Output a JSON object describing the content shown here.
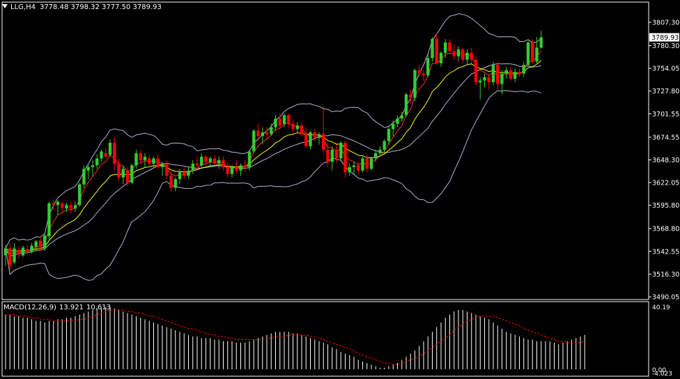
{
  "header": {
    "symbol_tf": "LLG,H4",
    "ohlc": "3778.48 3798.32 3777.50 3789.93"
  },
  "macd_header": {
    "name": "MACD(12,26,9)",
    "main": "13.921",
    "signal": "10.613"
  },
  "colors": {
    "background": "#000000",
    "up_candle": "#32cd32",
    "down_candle": "#ff0000",
    "bollinger": "#b4b4d2",
    "ema_fast": "#ff3030",
    "ema_slow": "#ffff00",
    "macd_hist": "#ffffff",
    "macd_signal": "#ff0000",
    "axis": "#ffffff",
    "price_label_bg": "#ffffff"
  },
  "chart_data": [
    {
      "type": "candlestick",
      "series_name": "LLG,H4",
      "y_axis_ticks": [
        "3807.30",
        "3780.30",
        "3754.05",
        "3727.80",
        "3701.55",
        "3674.55",
        "3648.30",
        "3622.05",
        "3595.80",
        "3568.80",
        "3542.55",
        "3516.30",
        "3490.05"
      ],
      "ylim": [
        3490.05,
        3807.3
      ],
      "current_price_label": "3789.93",
      "candles": [
        {
          "o": 3538,
          "h": 3550,
          "l": 3526,
          "c": 3546
        },
        {
          "o": 3546,
          "h": 3552,
          "l": 3520,
          "c": 3526
        },
        {
          "o": 3530,
          "h": 3552,
          "l": 3528,
          "c": 3546
        },
        {
          "o": 3544,
          "h": 3548,
          "l": 3534,
          "c": 3539
        },
        {
          "o": 3538,
          "h": 3549,
          "l": 3536,
          "c": 3547
        },
        {
          "o": 3545,
          "h": 3549,
          "l": 3538,
          "c": 3542
        },
        {
          "o": 3542,
          "h": 3552,
          "l": 3540,
          "c": 3549
        },
        {
          "o": 3548,
          "h": 3556,
          "l": 3544,
          "c": 3554
        },
        {
          "o": 3555,
          "h": 3558,
          "l": 3544,
          "c": 3547
        },
        {
          "o": 3546,
          "h": 3564,
          "l": 3543,
          "c": 3561
        },
        {
          "o": 3560,
          "h": 3600,
          "l": 3556,
          "c": 3598
        },
        {
          "o": 3598,
          "h": 3603,
          "l": 3590,
          "c": 3596
        },
        {
          "o": 3596,
          "h": 3602,
          "l": 3584,
          "c": 3600
        },
        {
          "o": 3598,
          "h": 3600,
          "l": 3588,
          "c": 3593
        },
        {
          "o": 3592,
          "h": 3599,
          "l": 3588,
          "c": 3596
        },
        {
          "o": 3596,
          "h": 3600,
          "l": 3586,
          "c": 3592
        },
        {
          "o": 3592,
          "h": 3600,
          "l": 3588,
          "c": 3596
        },
        {
          "o": 3596,
          "h": 3622,
          "l": 3594,
          "c": 3620
        },
        {
          "o": 3620,
          "h": 3642,
          "l": 3616,
          "c": 3638
        },
        {
          "o": 3636,
          "h": 3642,
          "l": 3626,
          "c": 3640
        },
        {
          "o": 3640,
          "h": 3648,
          "l": 3630,
          "c": 3642
        },
        {
          "o": 3642,
          "h": 3655,
          "l": 3638,
          "c": 3650
        },
        {
          "o": 3650,
          "h": 3660,
          "l": 3646,
          "c": 3658
        },
        {
          "o": 3656,
          "h": 3662,
          "l": 3650,
          "c": 3652
        },
        {
          "o": 3654,
          "h": 3672,
          "l": 3652,
          "c": 3668
        },
        {
          "o": 3668,
          "h": 3674,
          "l": 3636,
          "c": 3644
        },
        {
          "o": 3644,
          "h": 3650,
          "l": 3624,
          "c": 3628
        },
        {
          "o": 3628,
          "h": 3642,
          "l": 3620,
          "c": 3638
        },
        {
          "o": 3636,
          "h": 3640,
          "l": 3618,
          "c": 3622
        },
        {
          "o": 3622,
          "h": 3644,
          "l": 3620,
          "c": 3642
        },
        {
          "o": 3642,
          "h": 3660,
          "l": 3638,
          "c": 3656
        },
        {
          "o": 3656,
          "h": 3660,
          "l": 3644,
          "c": 3648
        },
        {
          "o": 3648,
          "h": 3656,
          "l": 3640,
          "c": 3652
        },
        {
          "o": 3650,
          "h": 3654,
          "l": 3640,
          "c": 3644
        },
        {
          "o": 3644,
          "h": 3652,
          "l": 3640,
          "c": 3650
        },
        {
          "o": 3650,
          "h": 3654,
          "l": 3638,
          "c": 3640
        },
        {
          "o": 3640,
          "h": 3646,
          "l": 3630,
          "c": 3644
        },
        {
          "o": 3644,
          "h": 3648,
          "l": 3626,
          "c": 3630
        },
        {
          "o": 3630,
          "h": 3634,
          "l": 3612,
          "c": 3616
        },
        {
          "o": 3616,
          "h": 3628,
          "l": 3612,
          "c": 3626
        },
        {
          "o": 3626,
          "h": 3638,
          "l": 3620,
          "c": 3634
        },
        {
          "o": 3634,
          "h": 3640,
          "l": 3626,
          "c": 3630
        },
        {
          "o": 3630,
          "h": 3640,
          "l": 3626,
          "c": 3636
        },
        {
          "o": 3636,
          "h": 3648,
          "l": 3632,
          "c": 3644
        },
        {
          "o": 3644,
          "h": 3652,
          "l": 3638,
          "c": 3642
        },
        {
          "o": 3642,
          "h": 3656,
          "l": 3640,
          "c": 3652
        },
        {
          "o": 3652,
          "h": 3654,
          "l": 3642,
          "c": 3646
        },
        {
          "o": 3646,
          "h": 3652,
          "l": 3640,
          "c": 3650
        },
        {
          "o": 3650,
          "h": 3654,
          "l": 3642,
          "c": 3644
        },
        {
          "o": 3644,
          "h": 3652,
          "l": 3638,
          "c": 3648
        },
        {
          "o": 3648,
          "h": 3652,
          "l": 3636,
          "c": 3640
        },
        {
          "o": 3640,
          "h": 3646,
          "l": 3628,
          "c": 3632
        },
        {
          "o": 3632,
          "h": 3642,
          "l": 3628,
          "c": 3640
        },
        {
          "o": 3640,
          "h": 3648,
          "l": 3632,
          "c": 3636
        },
        {
          "o": 3636,
          "h": 3644,
          "l": 3630,
          "c": 3642
        },
        {
          "o": 3642,
          "h": 3648,
          "l": 3634,
          "c": 3640
        },
        {
          "o": 3640,
          "h": 3660,
          "l": 3636,
          "c": 3658
        },
        {
          "o": 3658,
          "h": 3684,
          "l": 3656,
          "c": 3682
        },
        {
          "o": 3682,
          "h": 3690,
          "l": 3670,
          "c": 3676
        },
        {
          "o": 3676,
          "h": 3686,
          "l": 3666,
          "c": 3680
        },
        {
          "o": 3680,
          "h": 3686,
          "l": 3672,
          "c": 3678
        },
        {
          "o": 3678,
          "h": 3690,
          "l": 3676,
          "c": 3686
        },
        {
          "o": 3686,
          "h": 3700,
          "l": 3682,
          "c": 3696
        },
        {
          "o": 3696,
          "h": 3702,
          "l": 3684,
          "c": 3688
        },
        {
          "o": 3690,
          "h": 3702,
          "l": 3686,
          "c": 3700
        },
        {
          "o": 3700,
          "h": 3702,
          "l": 3686,
          "c": 3690
        },
        {
          "o": 3690,
          "h": 3694,
          "l": 3680,
          "c": 3684
        },
        {
          "o": 3684,
          "h": 3692,
          "l": 3680,
          "c": 3688
        },
        {
          "o": 3688,
          "h": 3692,
          "l": 3676,
          "c": 3678
        },
        {
          "o": 3678,
          "h": 3686,
          "l": 3662,
          "c": 3664
        },
        {
          "o": 3664,
          "h": 3682,
          "l": 3660,
          "c": 3680
        },
        {
          "o": 3680,
          "h": 3684,
          "l": 3670,
          "c": 3674
        },
        {
          "o": 3674,
          "h": 3680,
          "l": 3666,
          "c": 3678
        },
        {
          "o": 3678,
          "h": 3710,
          "l": 3656,
          "c": 3660
        },
        {
          "o": 3660,
          "h": 3668,
          "l": 3640,
          "c": 3646
        },
        {
          "o": 3646,
          "h": 3664,
          "l": 3636,
          "c": 3660
        },
        {
          "o": 3660,
          "h": 3666,
          "l": 3644,
          "c": 3650
        },
        {
          "o": 3650,
          "h": 3670,
          "l": 3646,
          "c": 3668
        },
        {
          "o": 3668,
          "h": 3670,
          "l": 3628,
          "c": 3634
        },
        {
          "o": 3634,
          "h": 3644,
          "l": 3630,
          "c": 3640
        },
        {
          "o": 3640,
          "h": 3646,
          "l": 3632,
          "c": 3642
        },
        {
          "o": 3642,
          "h": 3646,
          "l": 3632,
          "c": 3636
        },
        {
          "o": 3636,
          "h": 3652,
          "l": 3634,
          "c": 3650
        },
        {
          "o": 3650,
          "h": 3654,
          "l": 3634,
          "c": 3638
        },
        {
          "o": 3638,
          "h": 3652,
          "l": 3636,
          "c": 3650
        },
        {
          "o": 3650,
          "h": 3660,
          "l": 3646,
          "c": 3656
        },
        {
          "o": 3656,
          "h": 3664,
          "l": 3652,
          "c": 3660
        },
        {
          "o": 3660,
          "h": 3672,
          "l": 3656,
          "c": 3670
        },
        {
          "o": 3670,
          "h": 3686,
          "l": 3666,
          "c": 3684
        },
        {
          "o": 3684,
          "h": 3694,
          "l": 3676,
          "c": 3690
        },
        {
          "o": 3690,
          "h": 3700,
          "l": 3686,
          "c": 3696
        },
        {
          "o": 3696,
          "h": 3704,
          "l": 3692,
          "c": 3700
        },
        {
          "o": 3700,
          "h": 3726,
          "l": 3698,
          "c": 3724
        },
        {
          "o": 3724,
          "h": 3730,
          "l": 3714,
          "c": 3720
        },
        {
          "o": 3720,
          "h": 3754,
          "l": 3716,
          "c": 3752
        },
        {
          "o": 3752,
          "h": 3758,
          "l": 3744,
          "c": 3748
        },
        {
          "o": 3748,
          "h": 3752,
          "l": 3740,
          "c": 3746
        },
        {
          "o": 3746,
          "h": 3770,
          "l": 3744,
          "c": 3766
        },
        {
          "o": 3766,
          "h": 3790,
          "l": 3762,
          "c": 3788
        },
        {
          "o": 3788,
          "h": 3794,
          "l": 3758,
          "c": 3760
        },
        {
          "o": 3760,
          "h": 3774,
          "l": 3756,
          "c": 3772
        },
        {
          "o": 3772,
          "h": 3788,
          "l": 3766,
          "c": 3784
        },
        {
          "o": 3784,
          "h": 3788,
          "l": 3770,
          "c": 3774
        },
        {
          "o": 3774,
          "h": 3782,
          "l": 3764,
          "c": 3768
        },
        {
          "o": 3768,
          "h": 3780,
          "l": 3762,
          "c": 3776
        },
        {
          "o": 3776,
          "h": 3778,
          "l": 3760,
          "c": 3764
        },
        {
          "o": 3764,
          "h": 3776,
          "l": 3758,
          "c": 3772
        },
        {
          "o": 3772,
          "h": 3778,
          "l": 3760,
          "c": 3764
        },
        {
          "o": 3764,
          "h": 3768,
          "l": 3734,
          "c": 3738
        },
        {
          "o": 3738,
          "h": 3744,
          "l": 3718,
          "c": 3740
        },
        {
          "o": 3740,
          "h": 3748,
          "l": 3732,
          "c": 3744
        },
        {
          "o": 3744,
          "h": 3748,
          "l": 3730,
          "c": 3738
        },
        {
          "o": 3738,
          "h": 3762,
          "l": 3734,
          "c": 3758
        },
        {
          "o": 3758,
          "h": 3762,
          "l": 3730,
          "c": 3736
        },
        {
          "o": 3736,
          "h": 3752,
          "l": 3724,
          "c": 3748
        },
        {
          "o": 3748,
          "h": 3756,
          "l": 3742,
          "c": 3752
        },
        {
          "o": 3752,
          "h": 3756,
          "l": 3740,
          "c": 3742
        },
        {
          "o": 3742,
          "h": 3754,
          "l": 3738,
          "c": 3750
        },
        {
          "o": 3750,
          "h": 3754,
          "l": 3744,
          "c": 3748
        },
        {
          "o": 3748,
          "h": 3762,
          "l": 3744,
          "c": 3758
        },
        {
          "o": 3758,
          "h": 3786,
          "l": 3756,
          "c": 3784
        },
        {
          "o": 3784,
          "h": 3788,
          "l": 3760,
          "c": 3762
        },
        {
          "o": 3762,
          "h": 3790,
          "l": 3760,
          "c": 3778
        },
        {
          "o": 3778,
          "h": 3798,
          "l": 3777,
          "c": 3790
        }
      ]
    },
    {
      "type": "bar",
      "series_name": "MACD(12,26,9)",
      "y_axis_ticks": [
        "40.19",
        "0.00",
        "-4.023"
      ],
      "ylim": [
        -4.023,
        40.19
      ],
      "histogram": [
        35,
        35,
        34,
        34,
        33,
        33,
        32,
        31,
        31,
        30,
        31,
        31,
        32,
        32,
        33,
        33,
        34,
        35,
        36,
        37,
        38,
        39,
        39,
        40,
        40,
        39,
        38,
        37,
        36,
        35,
        34,
        33,
        32,
        31,
        30,
        29,
        28,
        27,
        26,
        25,
        24,
        23,
        22,
        21,
        21,
        20,
        20,
        20,
        19,
        19,
        18,
        18,
        18,
        17,
        17,
        17,
        18,
        19,
        20,
        21,
        22,
        23,
        24,
        24,
        24,
        24,
        23,
        23,
        22,
        21,
        20,
        19,
        18,
        17,
        16,
        14,
        13,
        11,
        10,
        9,
        8,
        6,
        5,
        4,
        3,
        2,
        1,
        1,
        2,
        3,
        4,
        6,
        8,
        10,
        12,
        15,
        18,
        21,
        24,
        27,
        30,
        33,
        35,
        37,
        38,
        38,
        37,
        36,
        35,
        34,
        33,
        32,
        30,
        28,
        26,
        24,
        23,
        22,
        21,
        20,
        19,
        19,
        18,
        18,
        18,
        18,
        17,
        16,
        17,
        18,
        19,
        20,
        21,
        22
      ],
      "signal": [
        35,
        35,
        35,
        34,
        34,
        34,
        33,
        33,
        32,
        32,
        32,
        31,
        31,
        31,
        31,
        31,
        31,
        32,
        32,
        33,
        34,
        35,
        36,
        37,
        38,
        38,
        38,
        38,
        37,
        37,
        36,
        36,
        35,
        34,
        34,
        33,
        32,
        31,
        30,
        29,
        28,
        27,
        26,
        26,
        25,
        24,
        23,
        22,
        22,
        21,
        21,
        20,
        20,
        19,
        19,
        19,
        19,
        19,
        19,
        19,
        20,
        20,
        21,
        21,
        21,
        22,
        22,
        22,
        22,
        22,
        21,
        21,
        20,
        19,
        18,
        17,
        16,
        15,
        14,
        13,
        12,
        10,
        9,
        8,
        7,
        6,
        5,
        4,
        4,
        3,
        3,
        4,
        5,
        6,
        7,
        8,
        10,
        12,
        14,
        16,
        18,
        20,
        22,
        25,
        27,
        29,
        31,
        32,
        33,
        34,
        34,
        34,
        34,
        33,
        32,
        31,
        30,
        29,
        28,
        26,
        25,
        24,
        23,
        22,
        21,
        20,
        19,
        18,
        18,
        17,
        17,
        17,
        17,
        18
      ]
    }
  ]
}
